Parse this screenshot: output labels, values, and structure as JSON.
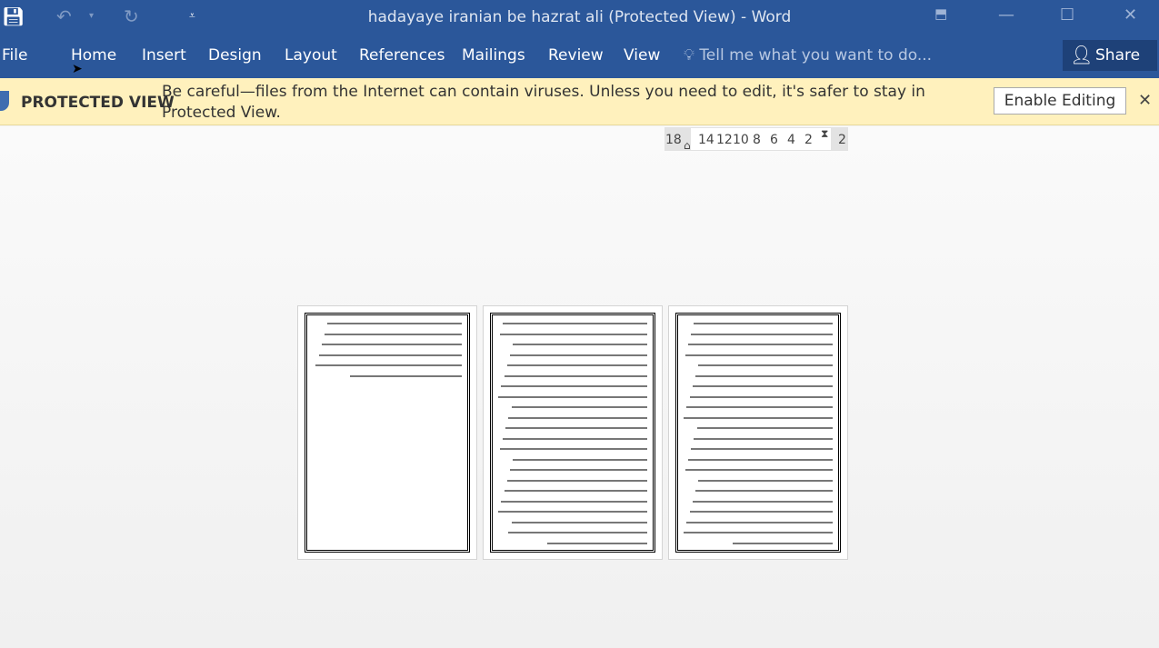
{
  "window": {
    "title": "hadayaye iranian be hazrat ali (Protected View) - Word"
  },
  "quick_access": {
    "icons": [
      "save-icon",
      "undo-icon",
      "redo-icon",
      "customize-icon"
    ]
  },
  "tabs": [
    "File",
    "Home",
    "Insert",
    "Design",
    "Layout",
    "References",
    "Mailings",
    "Review",
    "View"
  ],
  "tell_me": "Tell me what you want to do...",
  "share": "Share",
  "protected_view": {
    "label": "PROTECTED VIEW",
    "message": "Be careful—files from the Internet can contain viruses. Unless you need to edit, it's safer to stay in Protected View.",
    "button": "Enable Editing"
  },
  "ruler": {
    "ticks": [
      "18",
      "14",
      "12",
      "10",
      "8",
      "6",
      "4",
      "2",
      "2"
    ]
  },
  "pages": [
    {
      "lines": 6
    },
    {
      "lines": 22
    },
    {
      "lines": 22
    }
  ]
}
